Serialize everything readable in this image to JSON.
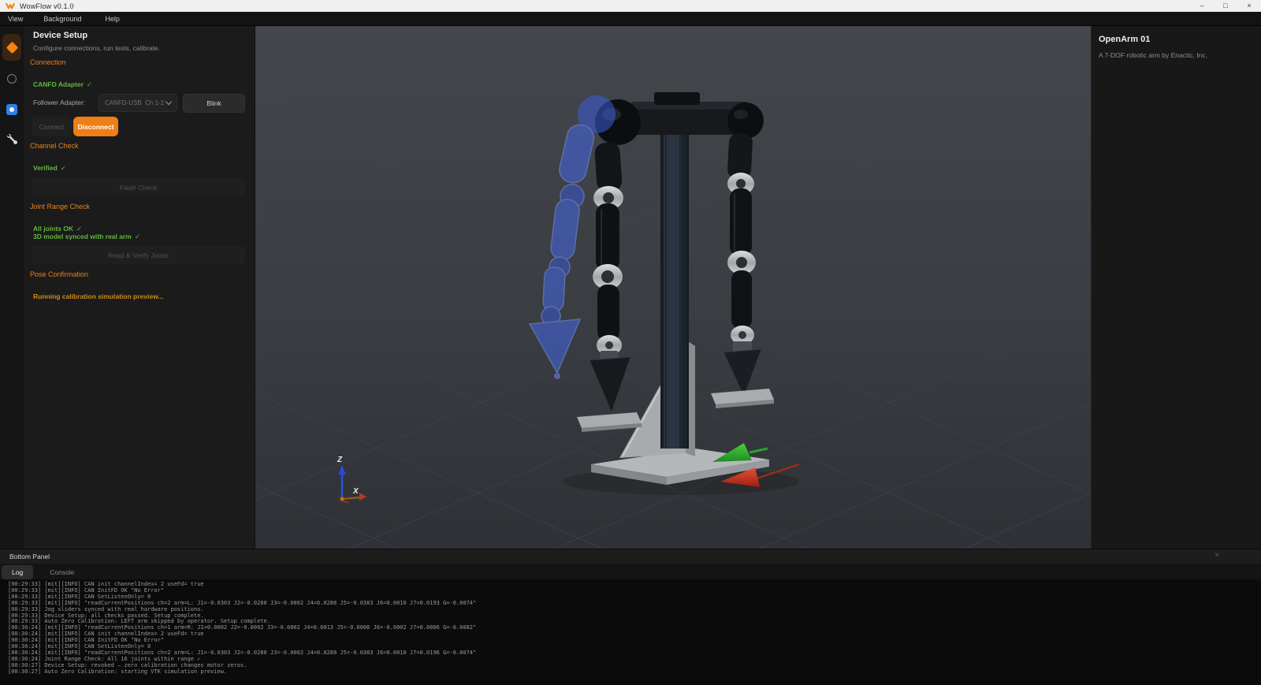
{
  "window": {
    "title": "WowFlow v0.1.0",
    "minimize": "–",
    "maximize": "□",
    "close": "×"
  },
  "menu": {
    "items": [
      {
        "label": "View"
      },
      {
        "label": "Background"
      },
      {
        "label": "Help"
      }
    ]
  },
  "sidebar": {
    "items": [
      {
        "icon": "diamond-icon",
        "active": true
      },
      {
        "icon": "circle-icon",
        "active": false
      },
      {
        "icon": "record-icon",
        "active": false
      },
      {
        "icon": "wrench-icon",
        "active": false
      }
    ]
  },
  "device_setup": {
    "title": "Device Setup",
    "subtitle": "Configure connections, run tests, calibrate.",
    "connection": {
      "header": "Connection",
      "adapter_status": "CANFD Adapter",
      "adapter_check": "✓",
      "follower_label": "Follower Adapter:",
      "follower_value": "CANFD-USB  Ch 1-2",
      "blink": "Blink",
      "connect": "Connect",
      "disconnect": "Disconnect"
    },
    "channel_check": {
      "header": "Channel Check",
      "status": "Verified",
      "check": "✓",
      "flash_button": "Flash Check"
    },
    "joint_range": {
      "header": "Joint Range Check",
      "status_1": "All joints OK",
      "check_1": "✓",
      "status_2": "3D model synced with real arm",
      "check_2": "✓",
      "read_button": "Read & Verify Joints"
    },
    "pose": {
      "header": "Pose Confirmation",
      "status": "Running calibration simulation preview..."
    }
  },
  "viewport": {
    "axis_z": "Z",
    "axis_x": "X"
  },
  "inspector": {
    "title": "OpenArm 01",
    "description": "A 7-DOF robotic arm by Enactic, Inc."
  },
  "bottom_panel": {
    "title": "Bottom Panel",
    "close": "×",
    "tabs": [
      {
        "label": "Log",
        "active": true
      },
      {
        "label": "Console",
        "active": false
      }
    ],
    "log_lines": [
      "[00:29:33] [mit][INFO] CAN init channelIndex= 2 useFd= true",
      "[00:29:33] [mit][INFO] CAN InitFD OK \"No Error\"",
      "[00:29:33] [mit][INFO] CAN SetListenOnly= 0",
      "[00:29:33] [mit][INFO] \"readCurrentPositions ch=2 arm=L: J1=-0.0303 J2=-0.0280 J3=-0.0002 J4=0.0288 J5=-0.0383 J6=0.0010 J7=0.0193 G=-0.0074\"",
      "[00:29:33] Jog sliders synced with real hardware positions.",
      "[00:29:33] Device Setup: all checks passed. Setup complete.",
      "[00:29:33] Auto Zero Calibration: LEFT arm skipped by operator. Setup complete.",
      "[00:30:24] [mit][INFO] \"readCurrentPositions ch=1 arm=R: J1=0.0002 J2=-0.0002 J3=-0.0002 J4=0.0013 J5=-0.0006 J6=-0.0002 J7=0.0006 G=-0.0082\"",
      "[00:30:24] [mit][INFO] CAN init channelIndex= 2 useFd= true",
      "[00:30:24] [mit][INFO] CAN InitFD OK \"No Error\"",
      "[00:30:24] [mit][INFO] CAN SetListenOnly= 0",
      "[00:30:24] [mit][INFO] \"readCurrentPositions ch=2 arm=L: J1=-0.0303 J2=-0.0280 J3=-0.0002 J4=0.0288 J5=-0.0383 J6=0.0010 J7=0.0196 G=-0.0074\"",
      "[00:30:24] Joint Range Check: All 16 joints within range ✓",
      "[00:30:27] Device Setup: revoked — zero calibration changes motor zeros.",
      "[00:30:27] Auto Zero Calibration: starting VTK simulation preview."
    ]
  },
  "colors": {
    "accent_orange": "#ee7f16",
    "section_orange": "#e8821c",
    "status_green": "#64b542",
    "gizmo_green": "#2fae37",
    "gizmo_red": "#d93025",
    "axis_blue": "#2b48d8",
    "ghost_blue": "#4468e8"
  }
}
